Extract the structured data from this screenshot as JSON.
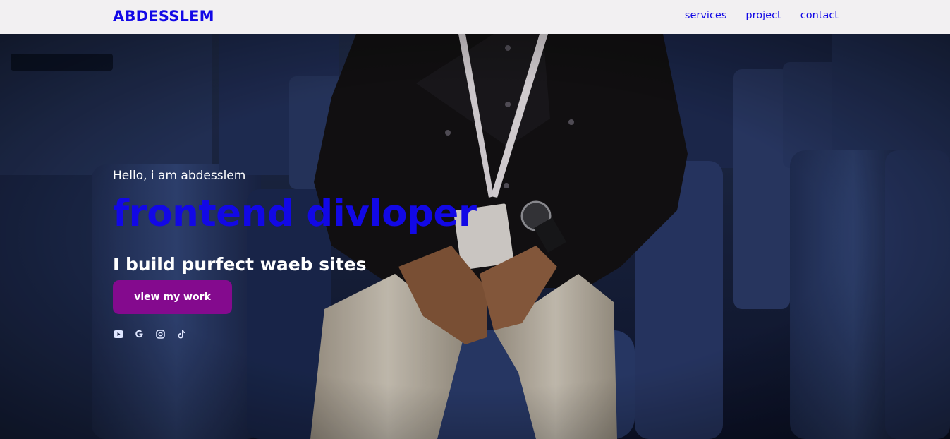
{
  "nav": {
    "logo": "ABDESSLEM",
    "links": [
      {
        "label": "services"
      },
      {
        "label": "project"
      },
      {
        "label": "contact"
      }
    ]
  },
  "hero": {
    "greeting": "Hello, i am abdesslem",
    "headline": "frontend divloper",
    "tagline": "I build purfect waeb sites",
    "cta_label": "view my work",
    "socials": [
      {
        "icon": "youtube-icon"
      },
      {
        "icon": "google-icon"
      },
      {
        "icon": "instagram-icon"
      },
      {
        "icon": "tiktok-icon"
      }
    ]
  },
  "colors": {
    "accent": "#1208e6",
    "button": "#840a8e",
    "navbar_bg": "#f2f0f2"
  }
}
